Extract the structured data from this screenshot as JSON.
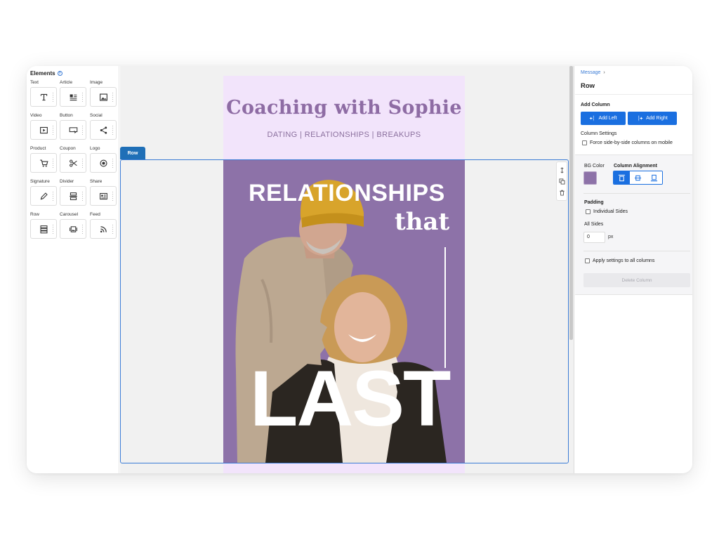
{
  "elements_panel": {
    "title": "Elements",
    "items": [
      {
        "label": "Text",
        "icon": "text-icon"
      },
      {
        "label": "Article",
        "icon": "article-icon"
      },
      {
        "label": "Image",
        "icon": "image-icon"
      },
      {
        "label": "Video",
        "icon": "video-icon"
      },
      {
        "label": "Button",
        "icon": "button-icon"
      },
      {
        "label": "Social",
        "icon": "social-icon"
      },
      {
        "label": "Product",
        "icon": "cart-icon"
      },
      {
        "label": "Coupon",
        "icon": "scissors-icon"
      },
      {
        "label": "Logo",
        "icon": "logo-icon"
      },
      {
        "label": "Signature",
        "icon": "pen-icon"
      },
      {
        "label": "Divider",
        "icon": "divider-icon"
      },
      {
        "label": "Share",
        "icon": "share-icon"
      },
      {
        "label": "Row",
        "icon": "row-icon"
      },
      {
        "label": "Carousel",
        "icon": "carousel-icon"
      },
      {
        "label": "Feed",
        "icon": "feed-icon"
      }
    ]
  },
  "canvas": {
    "row_tab": "Row",
    "email": {
      "brand": "Coaching with Sophie",
      "tagline": "DATING | RELATIONSHIPS | BREAKUPS",
      "hero_line1": "RELATIONSHIPS",
      "hero_line2": "that",
      "hero_line3": "LAST",
      "bg_color": "#8d72a8",
      "header_color": "#f2e4fb"
    }
  },
  "settings": {
    "breadcrumb": "Message",
    "title": "Row",
    "add_column_label": "Add Column",
    "add_left": "Add Left",
    "add_right": "Add Right",
    "column_settings_label": "Column Settings",
    "force_side_by_side": "Force side-by-side columns on mobile",
    "bg_color_label": "BG Color",
    "bg_color_value": "#8d72a8",
    "column_alignment_label": "Column Alignment",
    "padding_label": "Padding",
    "individual_sides": "Individual Sides",
    "all_sides_label": "All Sides",
    "all_sides_value": "0",
    "px_unit": "px",
    "apply_all": "Apply settings to all columns",
    "delete_column": "Delete Column",
    "accent_color": "#1a6fe0"
  }
}
